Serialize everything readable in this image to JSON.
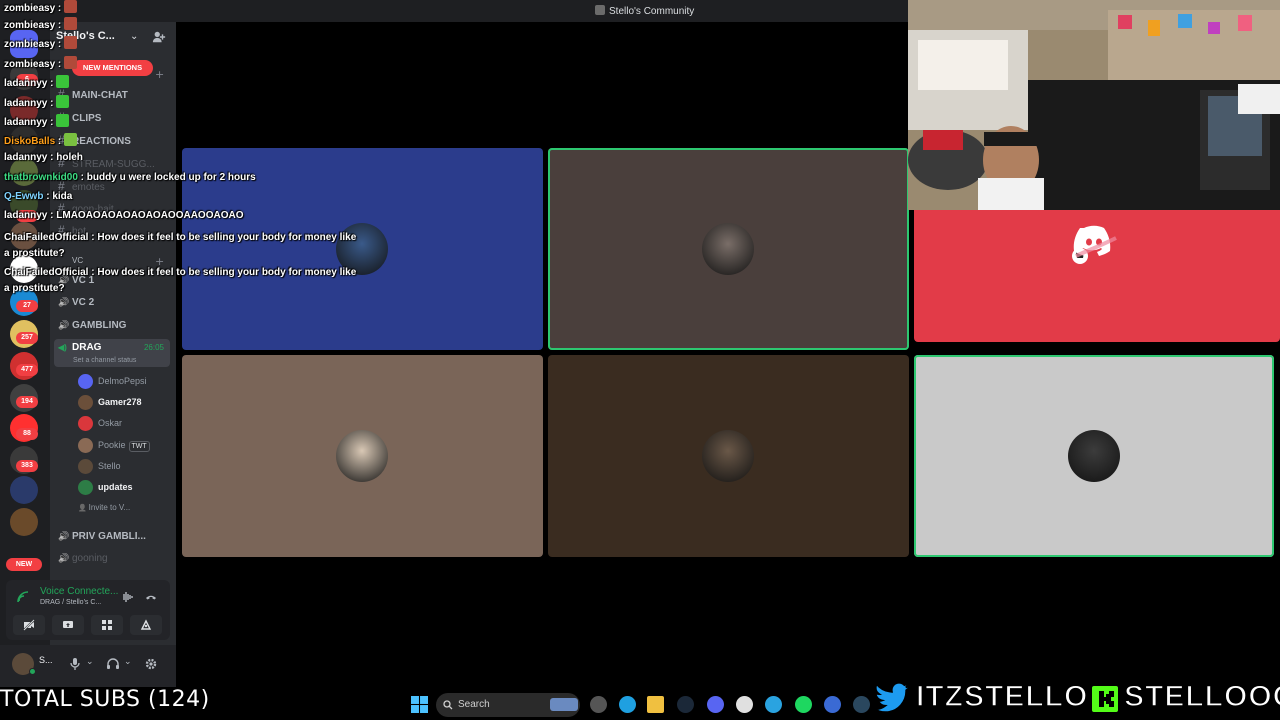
{
  "window": {
    "title": "Stello's Community"
  },
  "server": {
    "name": "Stello's C...",
    "mentions_label": "NEW MENTIONS"
  },
  "rail_badges": [
    "6",
    "1",
    "27",
    "257",
    "477",
    "194",
    "88",
    "383"
  ],
  "rail_new_label": "NEW",
  "channels": [
    {
      "type": "text",
      "name": "MAIN-CHAT"
    },
    {
      "type": "text",
      "name": "CLIPS"
    },
    {
      "type": "text",
      "name": "REACTIONS"
    },
    {
      "type": "text",
      "name": "STREAM-SUGG..."
    },
    {
      "type": "text",
      "name": "emotes"
    },
    {
      "type": "text",
      "name": "goon-bait"
    },
    {
      "type": "text",
      "name": "bot"
    },
    {
      "type": "category",
      "name": "VC"
    },
    {
      "type": "voice",
      "name": "VC 1"
    },
    {
      "type": "voice",
      "name": "VC 2"
    },
    {
      "type": "voice",
      "name": "GAMBLING"
    }
  ],
  "active_channel": {
    "name": "DRAG",
    "timer": "26:05",
    "status_placeholder": "Set a channel status"
  },
  "voice_users": [
    {
      "name": "DelmoPepsi",
      "color": "#5865f2"
    },
    {
      "name": "Gamer278",
      "color": "#6b4f3a"
    },
    {
      "name": "Oskar",
      "color": "#da373c"
    },
    {
      "name": "Pookie",
      "color": "#8a6a55",
      "tag": "TWT"
    },
    {
      "name": "Stello",
      "color": "#5b4a3a"
    },
    {
      "name": "updates",
      "color": "#2d7d46"
    }
  ],
  "invite_label": "Invite to V...",
  "channels_after": [
    {
      "type": "voice",
      "name": "PRIV GAMBLI..."
    },
    {
      "type": "voice",
      "name": "gooning"
    }
  ],
  "voice_panel": {
    "status": "Voice Connecte...",
    "location": "DRAG / Stello's C..."
  },
  "user": {
    "name": "S..."
  },
  "chat_messages": [
    {
      "user": "zombieasy",
      "text": "",
      "color": "#ffffff"
    },
    {
      "user": "zombieasy",
      "text": "",
      "color": "#ffffff"
    },
    {
      "user": "zombieasy",
      "text": "",
      "color": "#ffffff"
    },
    {
      "user": "zombieasy",
      "text": "",
      "color": "#ffffff"
    },
    {
      "user": "ladannyy",
      "text": "",
      "color": "#ffffff"
    },
    {
      "user": "ladannyy",
      "text": "",
      "color": "#ffffff"
    },
    {
      "user": "ladannyy",
      "text": "",
      "color": "#ffffff"
    },
    {
      "user": "DiskoBalls",
      "text": "",
      "color": "#ff9f1a"
    },
    {
      "user": "ladannyy",
      "text": "holeh",
      "color": "#ffffff"
    },
    {
      "user": "thatbrownkid00",
      "text": "buddy u were locked up for 2 hours",
      "color": "#3ddc84"
    },
    {
      "user": "Q-Ewwb",
      "text": "kida",
      "color": "#7fd3ff"
    },
    {
      "user": "ladannyy",
      "text": "LMAOAOAOAOAOAOAOOAAOOAOAO",
      "color": "#ffffff"
    },
    {
      "user": "ChaiFailedOfficial",
      "text": "How does it feel to be selling your body for money like a prostitute?",
      "color": "#ffffff"
    },
    {
      "user": "ChaiFailedOfficial",
      "text": "How does it feel to be selling your body for money like a prostitute?",
      "color": "#ffffff"
    }
  ],
  "tiles": [
    {
      "bg": "#2b3c8c",
      "speaking": false,
      "pfp": "#3a5a8a"
    },
    {
      "bg": "#4a3f3c",
      "speaking": true,
      "pfp": "#7a6e68"
    },
    {
      "bg": "#e23b48",
      "speaking": false,
      "pfp": "discord"
    },
    {
      "bg": "#7a6558",
      "speaking": false,
      "pfp": "#d9c8b5"
    },
    {
      "bg": "#3a2c20",
      "speaking": false,
      "pfp": "#6a5848"
    },
    {
      "bg": "#c9c9c9",
      "speaking": true,
      "pfp": "#3c3c3c"
    }
  ],
  "overlay": {
    "subs": "TOTAL SUBS (124)",
    "twitter_handle": "ITZSTELLOO",
    "kick_handle": "STELLOOO"
  },
  "taskbar": {
    "search_placeholder": "Search"
  }
}
